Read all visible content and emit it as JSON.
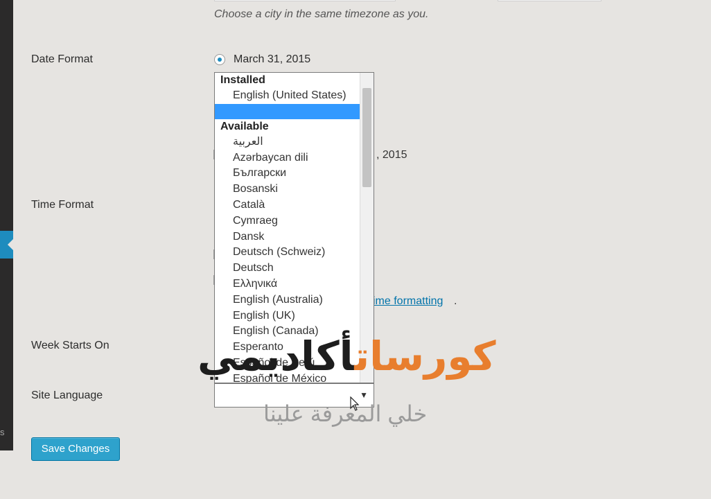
{
  "timezone": {
    "hint": "Choose a city in the same timezone as you."
  },
  "settings": {
    "date_format_label": "Date Format",
    "date_format_option": "March 31, 2015",
    "date_partial_behind": ", 2015",
    "time_format_label": "Time Format",
    "time_link_fragment": "ime formatting",
    "time_link_period": ".",
    "week_starts_label": "Week Starts On",
    "site_language_label": "Site Language",
    "save_button": "Save Changes"
  },
  "language_dropdown": {
    "installed_group": "Installed",
    "installed_options": [
      "English (United States)"
    ],
    "selected_option": "",
    "available_group": "Available",
    "available_options": [
      "العربية",
      "Azərbaycan dili",
      "Български",
      "Bosanski",
      "Català",
      "Cymraeg",
      "Dansk",
      "Deutsch (Schweiz)",
      "Deutsch",
      "Ελληνικά",
      "English (Australia)",
      "English (UK)",
      "English (Canada)",
      "Esperanto",
      "Español de Perú",
      "Español de México"
    ],
    "select_value": "",
    "caret": "▼"
  },
  "watermark": {
    "title_orange": "كورسات",
    "title_dark": "أكاديمي",
    "subtitle": "خلي المعرفة علينا"
  },
  "adminbar": {
    "stub_char": "s"
  },
  "colors": {
    "accent": "#1e8cbe",
    "selected_row": "#3299ff",
    "button": "#2ea2cc",
    "link": "#0073aa",
    "watermark_orange": "#e87e2e"
  }
}
